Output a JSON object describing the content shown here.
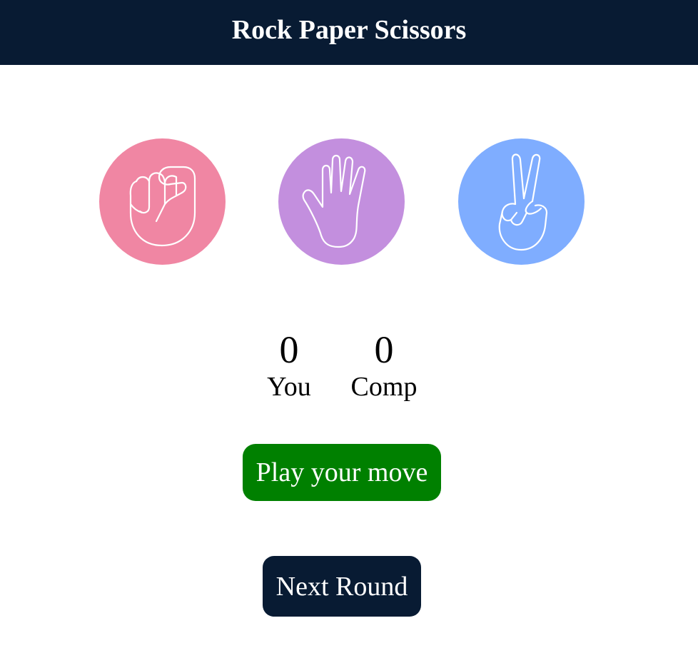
{
  "header": {
    "title": "Rock Paper Scissors"
  },
  "choices": [
    {
      "id": "rock",
      "icon": "rock-fist-icon",
      "color": "#f086a3"
    },
    {
      "id": "paper",
      "icon": "paper-hand-icon",
      "color": "#c38fde"
    },
    {
      "id": "scissors",
      "icon": "scissors-peace-icon",
      "color": "#7fadff"
    }
  ],
  "score": {
    "user_score": "0",
    "user_label": "You",
    "comp_score": "0",
    "comp_label": "Comp"
  },
  "message": {
    "text": "Play your move",
    "color": "#008000"
  },
  "next_round": {
    "label": "Next Round",
    "color": "#081b33"
  },
  "colors": {
    "header_bg": "#081b33"
  }
}
